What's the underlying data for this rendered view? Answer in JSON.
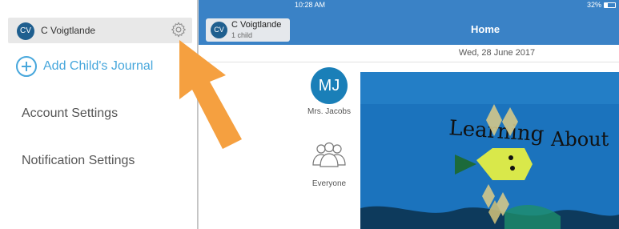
{
  "left_menu": {
    "user": {
      "initials": "CV",
      "name": "C Voigtlande",
      "settings_icon": "gear-icon"
    },
    "add_journal_label": "Add Child's Journal",
    "items": [
      {
        "label": "Account Settings"
      },
      {
        "label": "Notification Settings"
      }
    ]
  },
  "annotation": {
    "arrow_color": "#f5a040",
    "icon": "arrow-pointer"
  },
  "status_bar": {
    "time": "10:28 AM",
    "battery": "32%"
  },
  "nav": {
    "user_initials": "CV",
    "user_name": "C Voigtlande",
    "user_sub": "1 child",
    "title": "Home"
  },
  "feed": {
    "date": "Wed, 28 June 2017",
    "teacher": {
      "initials": "MJ",
      "name": "Mrs. Jacobs"
    },
    "audience_label": "Everyone",
    "photo_text": [
      "Learning",
      "About"
    ]
  },
  "colors": {
    "accent_blue": "#3a82c6",
    "link_blue": "#47a7dc",
    "avatar_blue": "#1f5f8f"
  }
}
